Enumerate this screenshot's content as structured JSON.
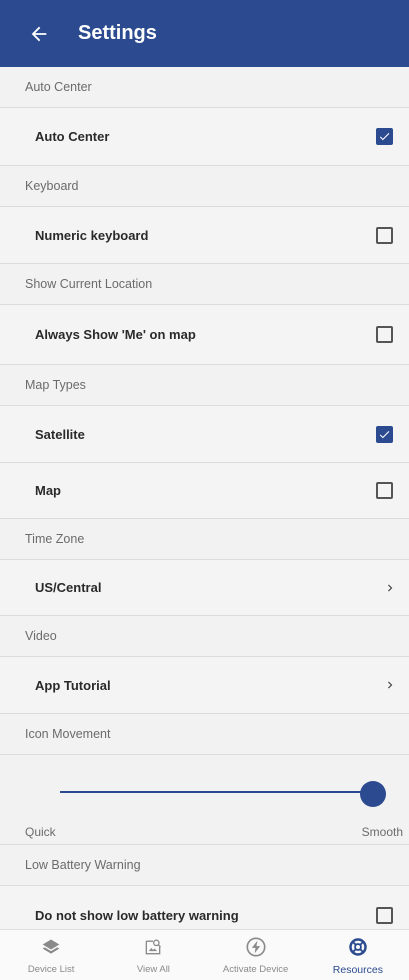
{
  "header": {
    "title": "Settings",
    "back_icon": "arrow-left-icon"
  },
  "sections": {
    "auto_center": {
      "header": "Auto Center",
      "label": "Auto Center",
      "checked": true
    },
    "keyboard": {
      "header": "Keyboard",
      "label": "Numeric keyboard",
      "checked": false
    },
    "show_location": {
      "header": "Show Current Location",
      "label": "Always Show 'Me' on map",
      "checked": false
    },
    "map_types": {
      "header": "Map Types",
      "satellite_label": "Satellite",
      "satellite_checked": true,
      "map_label": "Map",
      "map_checked": false
    },
    "time_zone": {
      "header": "Time Zone",
      "value": "US/Central"
    },
    "video": {
      "header": "Video",
      "label": "App Tutorial"
    },
    "icon_movement": {
      "header": "Icon Movement",
      "min_label": "Quick",
      "max_label": "Smooth",
      "value_fraction": 1.0
    },
    "low_battery": {
      "header": "Low Battery Warning",
      "label": "Do not show low battery warning",
      "checked": false
    }
  },
  "bottom_nav": [
    {
      "label": "Device List",
      "icon": "layers-icon",
      "active": false
    },
    {
      "label": "View All",
      "icon": "view-all-icon",
      "active": false
    },
    {
      "label": "Activate Device",
      "icon": "bolt-icon",
      "active": false
    },
    {
      "label": "Resources",
      "icon": "lifebuoy-icon",
      "active": true
    }
  ],
  "colors": {
    "primary": "#2b4a8f",
    "background": "#f2f2f2"
  }
}
